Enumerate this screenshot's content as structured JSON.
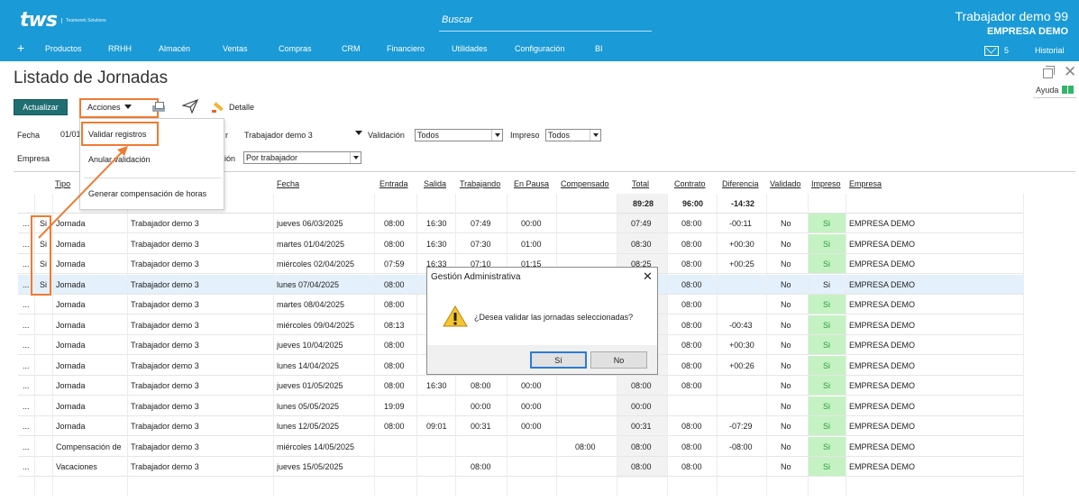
{
  "header": {
    "logo_text": "tws",
    "logo_sub": "Teamwork Solutions",
    "search_placeholder": "Buscar",
    "user_name": "Trabajador demo 99",
    "company": "EMPRESA DEMO",
    "nav_plus": "+",
    "nav": [
      "Productos",
      "RRHH",
      "Almacén",
      "Ventas",
      "Compras",
      "CRM",
      "Financiero",
      "Utilidades",
      "Configuración",
      "BI"
    ],
    "mail_count": "5",
    "historial": "Historial"
  },
  "page": {
    "title": "Listado de Jornadas",
    "help": "Ayuda"
  },
  "toolbar": {
    "actualizar": "Actualizar",
    "acciones": "Acciones",
    "detalle": "Detalle"
  },
  "menu": {
    "items": [
      "Validar registros",
      "Anular validación",
      "Generar compensación de horas"
    ]
  },
  "filters": {
    "fecha_label": "Fecha",
    "fecha_value": "01/01",
    "trabajador_label_tail": "r",
    "trabajador_value": "Trabajador demo 3",
    "validacion_label": "Validación",
    "validacion_value": "Todos",
    "impreso_label": "Impreso",
    "impreso_value": "Todos",
    "empresa_label": "Empresa",
    "agrupacion_label_tail": "ión",
    "agrupacion_value": "Por trabajador"
  },
  "table": {
    "headers": [
      "Tipo",
      "Fecha",
      "Entrada",
      "Salida",
      "Trabajando",
      "En Pausa",
      "Compensado",
      "Total",
      "Contrato",
      "Diferencia",
      "Validado",
      "Impreso",
      "Empresa"
    ],
    "totals": {
      "total": "89:28",
      "contrato": "96:00",
      "diferencia": "-14:32"
    },
    "rows": [
      {
        "sel": "...",
        "si": "Si",
        "tipo": "Jornada",
        "trab": "Trabajador demo 3",
        "fecha": "jueves 06/03/2025",
        "entrada": "08:00",
        "salida": "16:30",
        "trabajando": "07:49",
        "pausa": "00:00",
        "comp": "",
        "total": "07:49",
        "contrato": "08:00",
        "dif": "-00:11",
        "validado": "No",
        "impreso": "Si",
        "empresa": "EMPRESA DEMO"
      },
      {
        "sel": "...",
        "si": "Si",
        "tipo": "Jornada",
        "trab": "Trabajador demo 3",
        "fecha": "martes 01/04/2025",
        "entrada": "08:00",
        "salida": "16:30",
        "trabajando": "07:30",
        "pausa": "01:00",
        "comp": "",
        "total": "08:30",
        "contrato": "08:00",
        "dif": "+00:30",
        "validado": "No",
        "impreso": "Si",
        "empresa": "EMPRESA DEMO"
      },
      {
        "sel": "...",
        "si": "Si",
        "tipo": "Jornada",
        "trab": "Trabajador demo 3",
        "fecha": "miércoles 02/04/2025",
        "entrada": "07:59",
        "salida": "16:33",
        "trabajando": "07:10",
        "pausa": "01:15",
        "comp": "",
        "total": "08:25",
        "contrato": "08:00",
        "dif": "+00:25",
        "validado": "No",
        "impreso": "Si",
        "empresa": "EMPRESA DEMO"
      },
      {
        "sel": "...",
        "si": "Si",
        "tipo": "Jornada",
        "trab": "Trabajador demo 3",
        "fecha": "lunes 07/04/2025",
        "entrada": "08:00",
        "salida": "",
        "trabajando": "",
        "pausa": "",
        "comp": "",
        "total": "",
        "contrato": "08:00",
        "dif": "",
        "validado": "No",
        "impreso": "Si",
        "empresa": "EMPRESA DEMO"
      },
      {
        "sel": "...",
        "si": "",
        "tipo": "Jornada",
        "trab": "Trabajador demo 3",
        "fecha": "martes 08/04/2025",
        "entrada": "08:00",
        "salida": "",
        "trabajando": "",
        "pausa": "",
        "comp": "",
        "total": "",
        "contrato": "08:00",
        "dif": "",
        "validado": "No",
        "impreso": "Si",
        "empresa": "EMPRESA DEMO"
      },
      {
        "sel": "...",
        "si": "",
        "tipo": "Jornada",
        "trab": "Trabajador demo 3",
        "fecha": "miércoles 09/04/2025",
        "entrada": "08:13",
        "salida": "",
        "trabajando": "",
        "pausa": "",
        "comp": "",
        "total": "",
        "contrato": "08:00",
        "dif": "-00:43",
        "validado": "No",
        "impreso": "Si",
        "empresa": "EMPRESA DEMO"
      },
      {
        "sel": "...",
        "si": "",
        "tipo": "Jornada",
        "trab": "Trabajador demo 3",
        "fecha": "jueves 10/04/2025",
        "entrada": "08:00",
        "salida": "",
        "trabajando": "",
        "pausa": "",
        "comp": "",
        "total": "",
        "contrato": "08:00",
        "dif": "+00:30",
        "validado": "No",
        "impreso": "Si",
        "empresa": "EMPRESA DEMO"
      },
      {
        "sel": "...",
        "si": "",
        "tipo": "Jornada",
        "trab": "Trabajador demo 3",
        "fecha": "lunes 14/04/2025",
        "entrada": "08:00",
        "salida": "",
        "trabajando": "",
        "pausa": "",
        "comp": "",
        "total": "",
        "contrato": "08:00",
        "dif": "+00:26",
        "validado": "No",
        "impreso": "Si",
        "empresa": "EMPRESA DEMO"
      },
      {
        "sel": "...",
        "si": "",
        "tipo": "Jornada",
        "trab": "Trabajador demo 3",
        "fecha": "jueves 01/05/2025",
        "entrada": "08:00",
        "salida": "16:30",
        "trabajando": "08:00",
        "pausa": "00:00",
        "comp": "",
        "total": "08:00",
        "contrato": "08:00",
        "dif": "",
        "validado": "No",
        "impreso": "Si",
        "empresa": "EMPRESA DEMO"
      },
      {
        "sel": "...",
        "si": "",
        "tipo": "Jornada",
        "trab": "Trabajador demo 3",
        "fecha": "lunes 05/05/2025",
        "entrada": "19:09",
        "salida": "",
        "trabajando": "00:00",
        "pausa": "00:00",
        "comp": "",
        "total": "00:00",
        "contrato": "",
        "dif": "",
        "validado": "No",
        "impreso": "Si",
        "empresa": "EMPRESA DEMO"
      },
      {
        "sel": "...",
        "si": "",
        "tipo": "Jornada",
        "trab": "Trabajador demo 3",
        "fecha": "lunes 12/05/2025",
        "entrada": "08:00",
        "salida": "09:01",
        "trabajando": "00:31",
        "pausa": "00:00",
        "comp": "",
        "total": "00:31",
        "contrato": "08:00",
        "dif": "-07:29",
        "validado": "No",
        "impreso": "Si",
        "empresa": "EMPRESA DEMO"
      },
      {
        "sel": "...",
        "si": "",
        "tipo": "Compensación de",
        "trab": "Trabajador demo 3",
        "fecha": "miércoles 14/05/2025",
        "entrada": "",
        "salida": "",
        "trabajando": "",
        "pausa": "",
        "comp": "08:00",
        "total": "08:00",
        "contrato": "08:00",
        "dif": "-08:00",
        "validado": "No",
        "impreso": "Si",
        "empresa": "EMPRESA DEMO"
      },
      {
        "sel": "...",
        "si": "",
        "tipo": "Vacaciones",
        "trab": "Trabajador demo 3",
        "fecha": "jueves 15/05/2025",
        "entrada": "",
        "salida": "",
        "trabajando": "08:00",
        "pausa": "",
        "comp": "",
        "total": "08:00",
        "contrato": "08:00",
        "dif": "",
        "validado": "No",
        "impreso": "Si",
        "empresa": "EMPRESA DEMO"
      }
    ]
  },
  "dialog": {
    "title": "Gestión Administrativa",
    "message": "¿Desea validar las jornadas seleccionadas?",
    "yes": "Sí",
    "no": "No"
  },
  "colors": {
    "topbar": "#1a9ad6",
    "accent_orange": "#ee7b32",
    "btn_teal": "#1f6e72",
    "impreso_green": "#c5f2c3",
    "selected_row": "#e4f0fb"
  },
  "icons": {
    "print": "printer-icon",
    "send": "send-icon",
    "detalle": "pencil-icon",
    "warning": "warning-icon",
    "help": "book-icon",
    "mail": "mail-icon"
  }
}
